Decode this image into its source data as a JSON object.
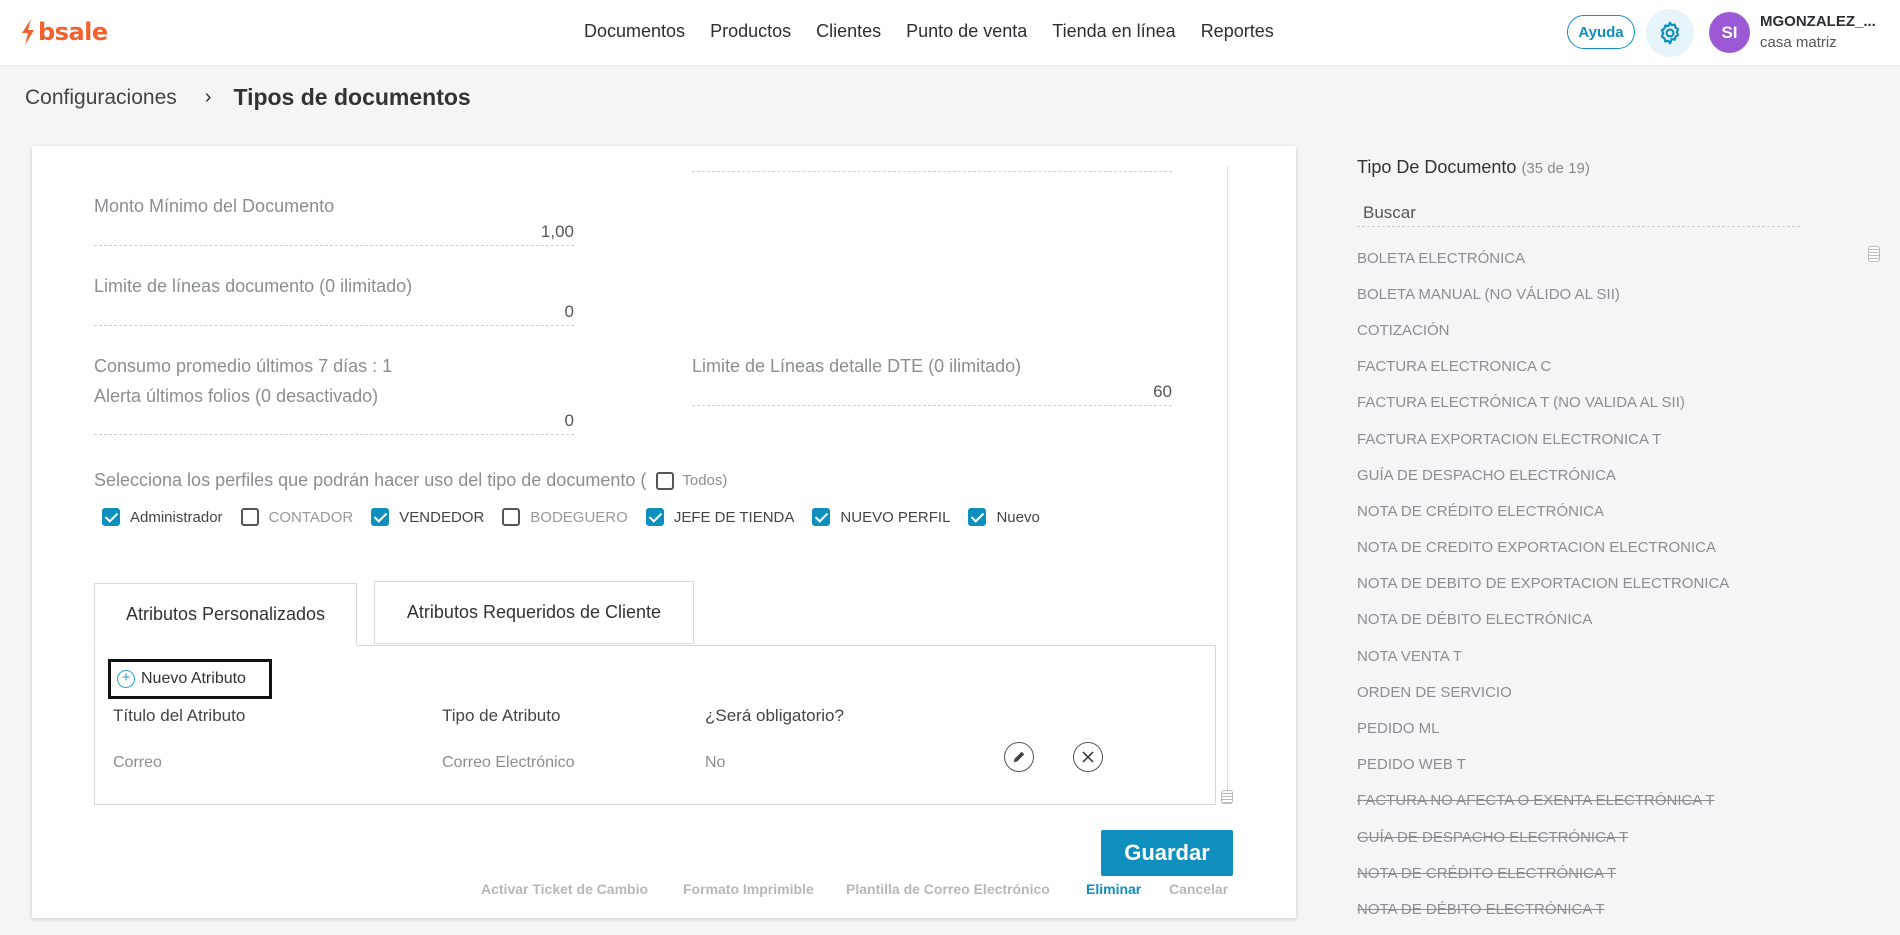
{
  "header": {
    "logo_text": "bsale",
    "nav": [
      "Documentos",
      "Productos",
      "Clientes",
      "Punto de venta",
      "Tienda en línea",
      "Reportes"
    ],
    "help_label": "Ayuda",
    "avatar_initials": "SI",
    "user_name": "MGONZALEZ_...",
    "user_branch": "casa matriz",
    "accent_color": "#0f8fbd",
    "brand_color": "#f2622e"
  },
  "breadcrumb": {
    "parent": "Configuraciones",
    "separator": "›",
    "current": "Tipos de documentos"
  },
  "form": {
    "min_amount_label": "Monto Mínimo del Documento",
    "min_amount_value": "1,00",
    "line_limit_label": "Limite de líneas documento (0 ilimitado)",
    "line_limit_value": "0",
    "avg_consumption_label": "Consumo promedio últimos 7 días : 1",
    "folio_alert_label": "Alerta últimos folios (0 desactivado)",
    "folio_alert_value": "0",
    "dte_line_limit_label": "Limite de Líneas detalle DTE (0 ilimitado)",
    "dte_line_limit_value": "60",
    "profiles_label": "Selecciona los perfiles que podrán hacer uso del tipo de documento (",
    "todos_label": "Todos)",
    "todos_checked": false,
    "profiles": [
      {
        "label": "Administrador",
        "checked": true
      },
      {
        "label": "CONTADOR",
        "checked": false
      },
      {
        "label": "VENDEDOR",
        "checked": true
      },
      {
        "label": "BODEGUERO",
        "checked": false
      },
      {
        "label": "JEFE DE TIENDA",
        "checked": true
      },
      {
        "label": "NUEVO PERFIL",
        "checked": true
      },
      {
        "label": "Nuevo",
        "checked": true
      }
    ]
  },
  "tabs": [
    {
      "label": "Atributos Personalizados",
      "active": true
    },
    {
      "label": "Atributos Requeridos de Cliente",
      "active": false
    }
  ],
  "attributes": {
    "new_button": "Nuevo Atributo",
    "columns": [
      "Título del Atributo",
      "Tipo de Atributo",
      "¿Será obligatorio?"
    ],
    "rows": [
      {
        "title": "Correo",
        "type": "Correo Electrónico",
        "required": "No"
      }
    ]
  },
  "actions": {
    "save": "Guardar",
    "links": [
      "Activar Ticket de Cambio",
      "Formato Imprimible",
      "Plantilla de Correo Electrónico",
      "Eliminar",
      "Cancelar"
    ]
  },
  "doc_types": {
    "title": "Tipo De Documento",
    "count": "(35 de 19)",
    "search_placeholder": "Buscar",
    "items": [
      {
        "label": "BOLETA ELECTRÓNICA",
        "disabled": false
      },
      {
        "label": "BOLETA MANUAL (NO VÁLIDO AL SII)",
        "disabled": false
      },
      {
        "label": "COTIZACIÓN",
        "disabled": false
      },
      {
        "label": "FACTURA ELECTRONICA C",
        "disabled": false
      },
      {
        "label": "FACTURA ELECTRÓNICA T (NO VALIDA AL SII)",
        "disabled": false
      },
      {
        "label": "FACTURA EXPORTACION ELECTRONICA T",
        "disabled": false
      },
      {
        "label": "GUÍA DE DESPACHO ELECTRÓNICA",
        "disabled": false
      },
      {
        "label": "NOTA DE CRÉDITO ELECTRÓNICA",
        "disabled": false
      },
      {
        "label": "NOTA DE CREDITO EXPORTACION ELECTRONICA",
        "disabled": false
      },
      {
        "label": "NOTA DE DEBITO DE EXPORTACION ELECTRONICA",
        "disabled": false
      },
      {
        "label": "NOTA DE DÉBITO ELECTRÓNICA",
        "disabled": false
      },
      {
        "label": "NOTA VENTA T",
        "disabled": false
      },
      {
        "label": "ORDEN DE SERVICIO",
        "disabled": false
      },
      {
        "label": "PEDIDO ML",
        "disabled": false
      },
      {
        "label": "PEDIDO WEB T",
        "disabled": false
      },
      {
        "label": "FACTURA NO AFECTA O EXENTA ELECTRÓNICA T",
        "disabled": true
      },
      {
        "label": "GUÍA DE DESPACHO ELECTRÓNICA T",
        "disabled": true
      },
      {
        "label": "NOTA DE CRÉDITO ELECTRÓNICA T",
        "disabled": true
      },
      {
        "label": "NOTA DE DÉBITO ELECTRÓNICA T",
        "disabled": true
      }
    ]
  }
}
